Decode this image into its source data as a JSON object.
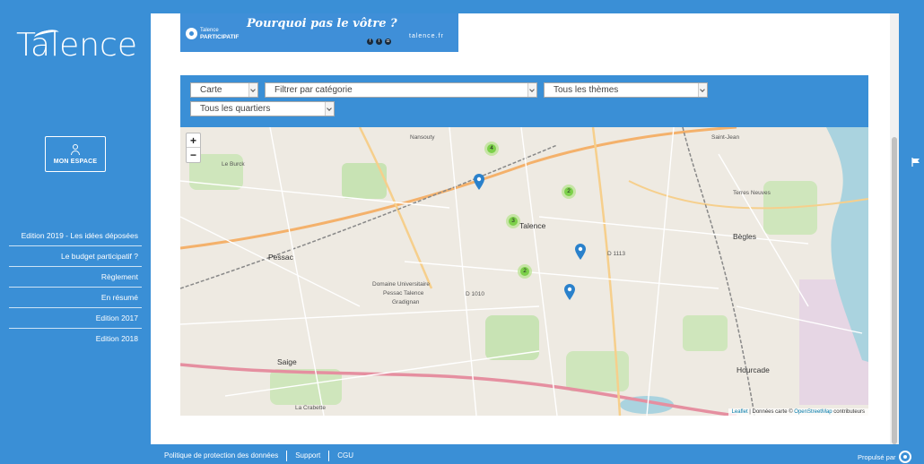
{
  "sidebar": {
    "logo": "Talence",
    "espace_label": "MON ESPACE",
    "items": [
      {
        "label": "Edition 2019 - Les idées déposées"
      },
      {
        "label": "Le budget participatif ?"
      },
      {
        "label": "Règlement"
      },
      {
        "label": "En résumé"
      },
      {
        "label": "Edition 2017"
      },
      {
        "label": "Edition 2018"
      }
    ]
  },
  "banner": {
    "brand_top": "Talence",
    "brand_bottom": "PARTICIPATIF",
    "slogan": "Pourquoi pas le vôtre ?",
    "url": "talence.fr"
  },
  "filters": {
    "view": "Carte",
    "category": "Filtrer par catégorie",
    "theme": "Tous les thèmes",
    "district": "Tous les quartiers"
  },
  "map": {
    "zoom_in": "+",
    "zoom_out": "−",
    "clusters": [
      "4",
      "2",
      "3",
      "2"
    ],
    "labels": {
      "talence": "Talence",
      "pessac": "Pessac",
      "begles": "Bègles",
      "nansouty": "Nansouty",
      "le_burck": "Le Burck",
      "domaine": "Domaine Universitaire",
      "domaine2": "Pessac Talence",
      "domaine3": "Gradignan",
      "saige": "Saige",
      "hourcade": "Hourcade",
      "terres_neuves": "Terres Neuves",
      "saint_jean": "Saint-Jean",
      "crabette": "La Crabette",
      "d1010": "D 1010",
      "d1113": "D 1113"
    },
    "attribution": {
      "leaflet": "Leaflet",
      "sep": " | Données carte © ",
      "osm": "OpenStreetMap",
      "suffix": " contributeurs"
    }
  },
  "footer": {
    "links": [
      "Politique de protection des données",
      "Support",
      "CGU"
    ],
    "powered": "Propulsé par"
  },
  "colors": {
    "brand": "#3a8fd6",
    "cluster": "#6ecc39",
    "pin": "#2a81cb"
  }
}
